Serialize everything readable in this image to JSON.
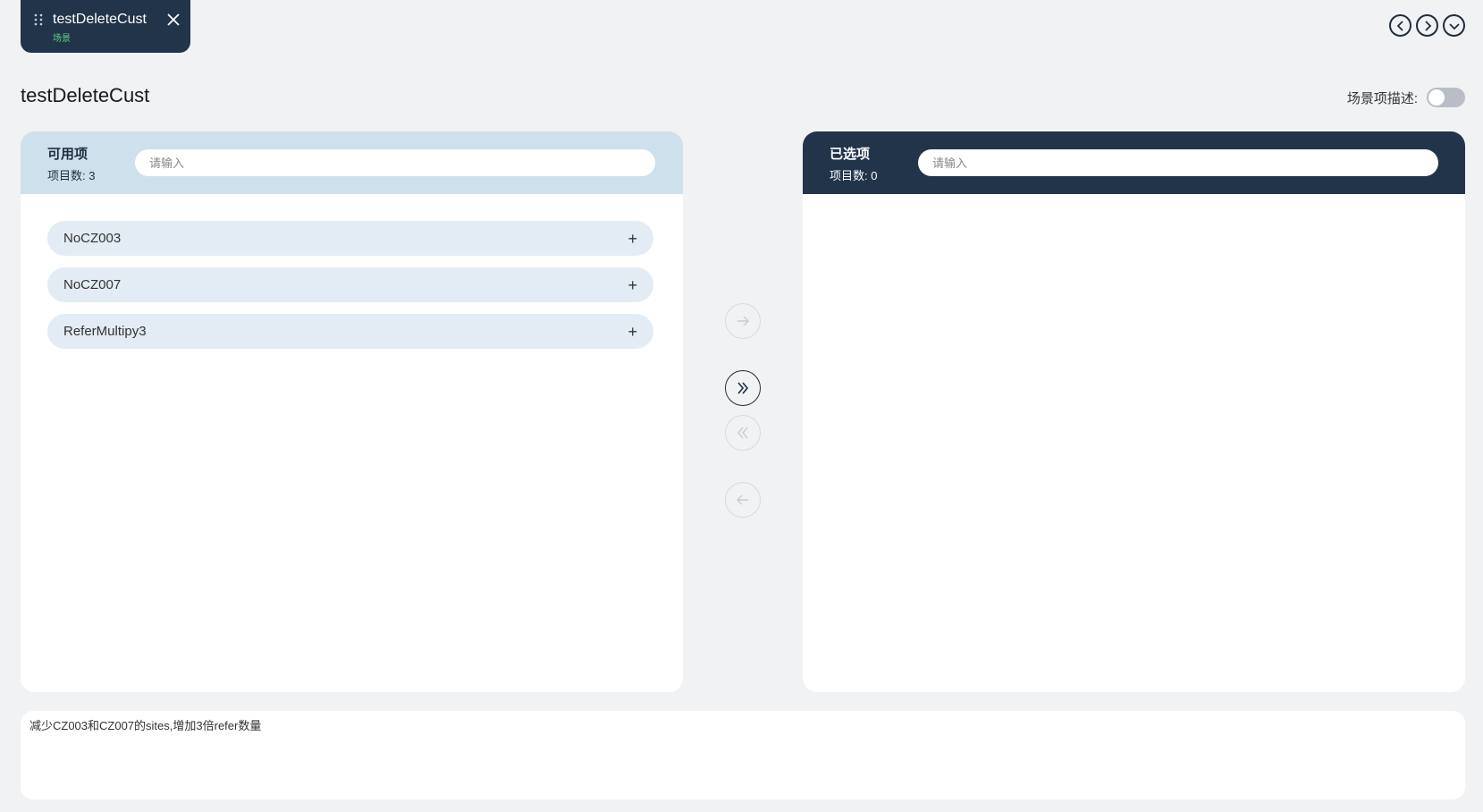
{
  "tab": {
    "title": "testDeleteCust",
    "subtitle": "场景"
  },
  "page": {
    "title": "testDeleteCust"
  },
  "description_toggle": {
    "label": "场景项描述:",
    "on": false
  },
  "available": {
    "title": "可用项",
    "count_label": "项目数:",
    "count": "3",
    "search_placeholder": "请输入",
    "items": [
      {
        "label": "NoCZ003"
      },
      {
        "label": "NoCZ007"
      },
      {
        "label": "ReferMultipy3"
      }
    ]
  },
  "selected": {
    "title": "已选项",
    "count_label": "项目数:",
    "count": "0",
    "search_placeholder": "请输入",
    "items": []
  },
  "transfer_buttons": [
    {
      "icon": "arrow-right-icon",
      "enabled": false
    },
    {
      "icon": "double-chevron-right-icon",
      "enabled": true
    },
    {
      "icon": "double-chevron-left-icon",
      "enabled": false
    },
    {
      "icon": "arrow-left-icon",
      "enabled": false
    }
  ],
  "notes": {
    "text": "减少CZ003和CZ007的sites,增加3倍refer数量"
  },
  "colors": {
    "dark": "#22344a",
    "light_head": "#cfe0ed",
    "item_bg": "#e3ecf4",
    "accent_green": "#5fd18a"
  }
}
